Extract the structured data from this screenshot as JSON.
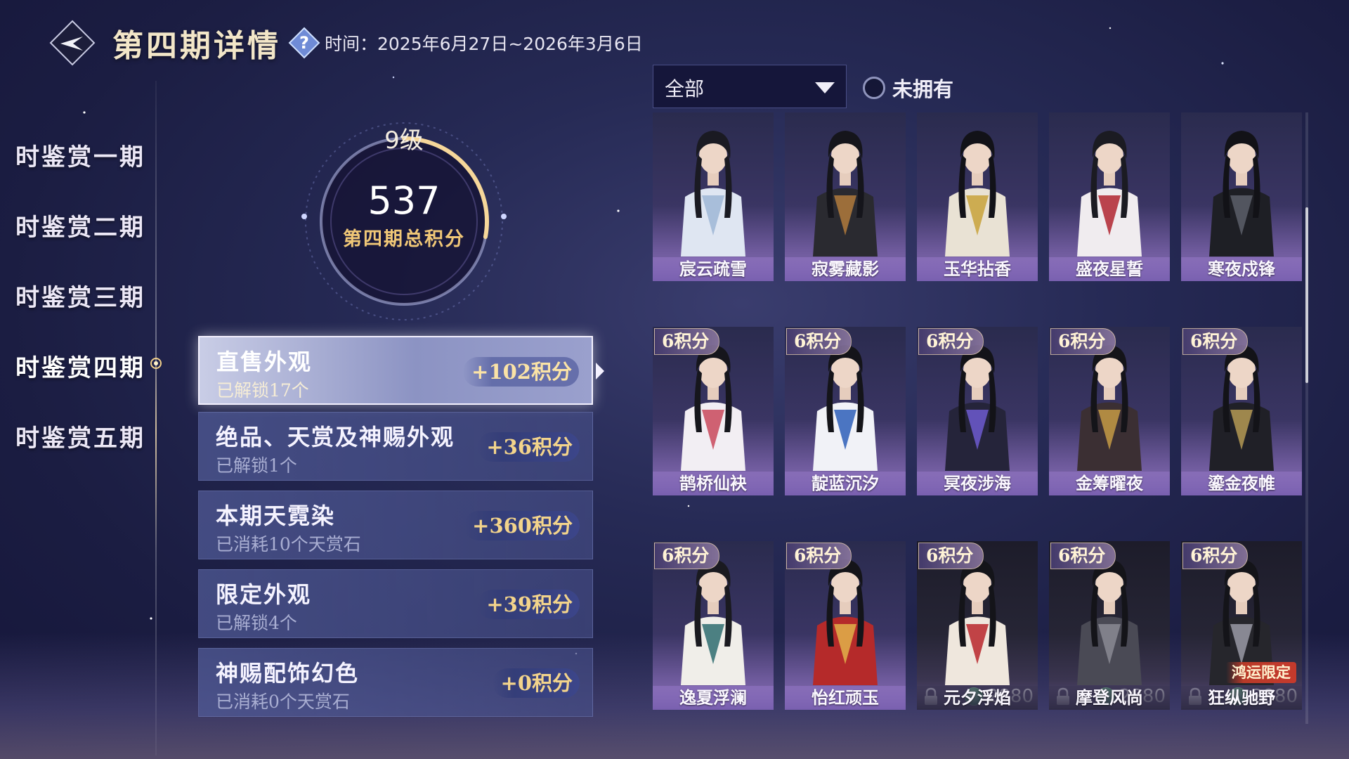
{
  "header": {
    "title": "第四期详情",
    "time_label": "时间：2025年6月27日~2026年3月6日"
  },
  "nav": {
    "items": [
      {
        "label": "时鉴赏一期"
      },
      {
        "label": "时鉴赏二期"
      },
      {
        "label": "时鉴赏三期"
      },
      {
        "label": "时鉴赏四期",
        "active": true
      },
      {
        "label": "时鉴赏五期"
      }
    ]
  },
  "score": {
    "level": "9级",
    "value": "537",
    "caption": "第四期总积分",
    "progress": 0.28
  },
  "categories": [
    {
      "title": "直售外观",
      "sub": "已解锁17个",
      "points": "+102积分",
      "active": true
    },
    {
      "title": "绝品、天赏及神赐外观",
      "sub": "已解锁1个",
      "points": "+36积分"
    },
    {
      "title": "本期天霓染",
      "sub": "已消耗10个天赏石",
      "points": "+360积分"
    },
    {
      "title": "限定外观",
      "sub": "已解锁4个",
      "points": "+39积分"
    },
    {
      "title": "神赐配饰幻色",
      "sub": "已消耗0个天赏石",
      "points": "+0积分"
    }
  ],
  "filter": {
    "selected": "全部",
    "toggle_label": "未拥有",
    "toggle_checked": false
  },
  "outfits": [
    {
      "name": "宸云疏雪",
      "points": "",
      "price": "",
      "tag": "",
      "hair": "#1a1a22",
      "cloth": "#dfe6f2",
      "accent": "#9fb6d6"
    },
    {
      "name": "寂雾藏影",
      "points": "",
      "price": "",
      "tag": "",
      "hair": "#15151b",
      "cloth": "#2a2a30",
      "accent": "#b07a3c"
    },
    {
      "name": "玉华拈香",
      "points": "",
      "price": "",
      "tag": "",
      "hair": "#121218",
      "cloth": "#e9e2d4",
      "accent": "#c8a23a"
    },
    {
      "name": "盛夜星誓",
      "points": "",
      "price": "",
      "tag": "",
      "hair": "#1b1b22",
      "cloth": "#f0ecef",
      "accent": "#b02630"
    },
    {
      "name": "寒夜戍锋",
      "points": "",
      "price": "",
      "tag": "",
      "hair": "#121217",
      "cloth": "#1e1f25",
      "accent": "#5c5f6a"
    },
    {
      "name": "鹊桥仙袂",
      "points": "6积分",
      "price": "",
      "tag": "",
      "hair": "#16161c",
      "cloth": "#f2eef3",
      "accent": "#c9485a"
    },
    {
      "name": "靛蓝沉汐",
      "points": "6积分",
      "price": "",
      "tag": "",
      "hair": "#141419",
      "cloth": "#f1f2f7",
      "accent": "#2e5fb8"
    },
    {
      "name": "冥夜涉海",
      "points": "6积分",
      "price": "",
      "tag": "",
      "hair": "#131318",
      "cloth": "#25243a",
      "accent": "#6d5bd0"
    },
    {
      "name": "金筹曜夜",
      "points": "6积分",
      "price": "",
      "tag": "",
      "hair": "#141419",
      "cloth": "#3b2f33",
      "accent": "#c69a45"
    },
    {
      "name": "鎏金夜帷",
      "points": "6积分",
      "price": "",
      "tag": "",
      "hair": "#131318",
      "cloth": "#202027",
      "accent": "#b59a55"
    },
    {
      "name": "逸夏浮澜",
      "points": "6积分",
      "price": "",
      "tag": "",
      "hair": "#1a1a20",
      "cloth": "#f0eee9",
      "accent": "#2f6c70"
    },
    {
      "name": "怡红顽玉",
      "points": "6积分",
      "price": "",
      "tag": "",
      "hair": "#141419",
      "cloth": "#b52a2a",
      "accent": "#e2b24a"
    },
    {
      "name": "元夕浮焰",
      "points": "6积分",
      "price": "2880",
      "tag": "",
      "hair": "#141419",
      "cloth": "#efe7dd",
      "accent": "#b8262b",
      "dark": true
    },
    {
      "name": "摩登风尚",
      "points": "6积分",
      "price": "2880",
      "tag": "",
      "hair": "#141419",
      "cloth": "#4a4a55",
      "accent": "#8a8a94",
      "dark": true
    },
    {
      "name": "狂纵驰野",
      "points": "6积分",
      "price": "2880",
      "tag": "鸿运限定",
      "hair": "#141419",
      "cloth": "#26262c",
      "accent": "#9a9aa6",
      "dark": true
    }
  ]
}
